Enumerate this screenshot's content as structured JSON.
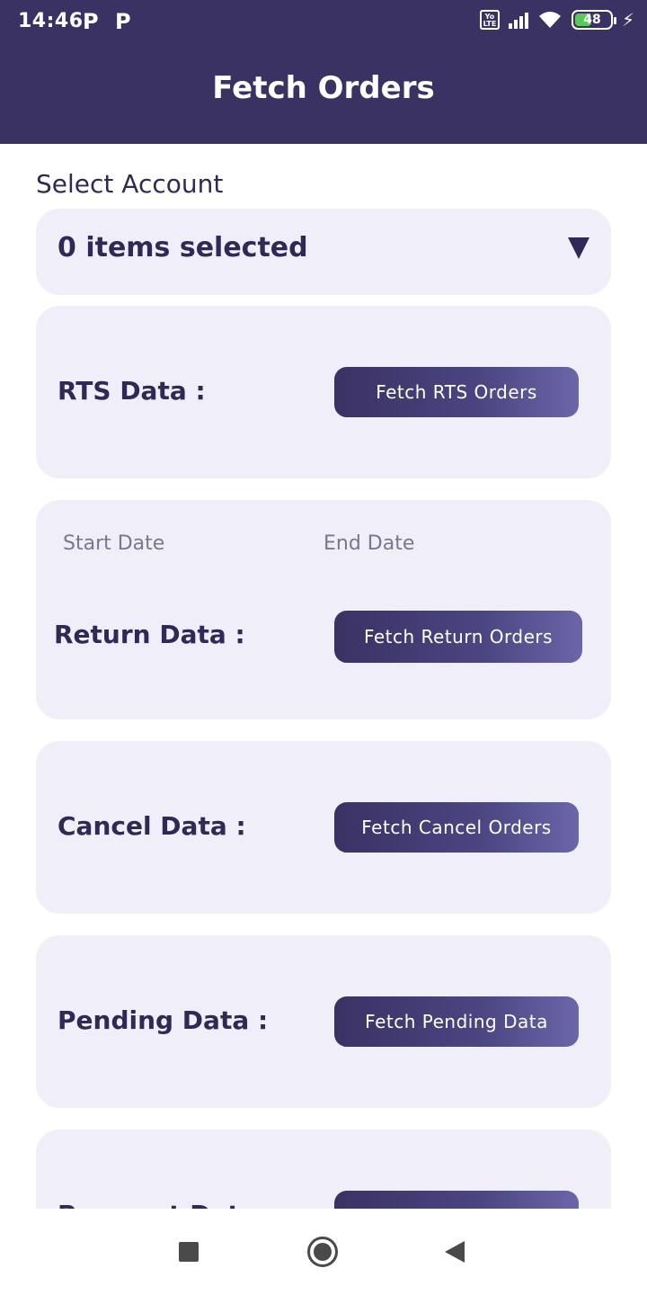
{
  "status_bar": {
    "time": "14:46",
    "notif_icons": [
      "P",
      "P"
    ],
    "lte_badge": "Yo LTE",
    "battery": "48"
  },
  "app_bar": {
    "title": "Fetch Orders"
  },
  "account": {
    "label": "Select Account",
    "selected_text": "0 items selected"
  },
  "sections": {
    "rts": {
      "label": "RTS Data :",
      "button": "Fetch RTS Orders"
    },
    "return": {
      "start_date_placeholder": "Start Date",
      "end_date_placeholder": "End Date",
      "label": "Return Data :",
      "button": "Fetch Return Orders"
    },
    "cancel": {
      "label": "Cancel Data :",
      "button": "Fetch Cancel Orders"
    },
    "pending": {
      "label": "Pending Data :",
      "button": "Fetch Pending Data"
    },
    "payment": {
      "label": "Payment Data :",
      "button": ""
    }
  },
  "colors": {
    "primary": "#3a3263",
    "card_bg": "#f0eef9",
    "text_dark": "#2f2a55",
    "battery_green": "#5ac85a"
  }
}
